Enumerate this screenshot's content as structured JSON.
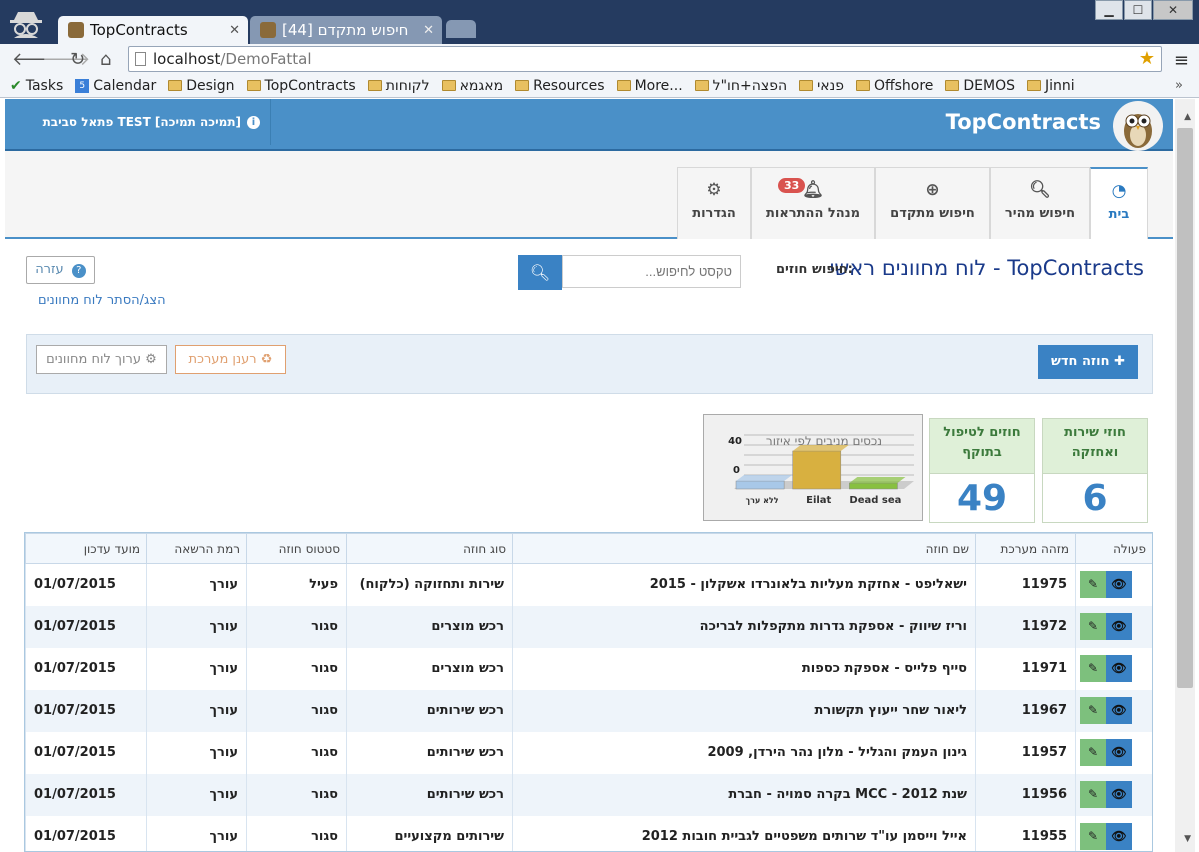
{
  "browser": {
    "tabs": [
      {
        "title": "TopContracts"
      },
      {
        "title": "[44] חיפוש מתקדם"
      }
    ],
    "url_host": "localhost",
    "url_path": "/DemoFattal",
    "window_buttons": {
      "min": "▁",
      "max": "☐",
      "close": "✕"
    },
    "bookmarks": [
      "Tasks",
      "Calendar",
      "Design",
      "TopContracts",
      "לקוחות",
      "מאגמא",
      "Resources",
      "More...",
      "הפצה+חו\"ל",
      "פנאי",
      "Offshore",
      "DEMOS",
      "Jinni"
    ],
    "bookmarks_more": "»"
  },
  "header": {
    "logo": "TopContracts",
    "env": "פתאל סביבת TEST [תמיכה תמיכה]"
  },
  "nav": {
    "tabs": [
      {
        "label": "בית",
        "icon": "dashboard-icon"
      },
      {
        "label": "חיפוש מהיר",
        "icon": "search-icon"
      },
      {
        "label": "חיפוש מתקדם",
        "icon": "zoom-in-icon"
      },
      {
        "label": "מנהל ההתראות",
        "icon": "bell-icon",
        "badge": "33"
      },
      {
        "label": "הגדרות",
        "icon": "gear-icon"
      }
    ]
  },
  "page": {
    "title": "לוח מחוונים ראשי - TopContracts",
    "search_label": "חיפוש חוזים:",
    "search_placeholder": "טקסט לחיפוש...",
    "help": "עזרה",
    "toggle_dashboard": "הצג/הסתר לוח מחוונים",
    "new_contract": "חוזה חדש",
    "refresh_system": "רענן מערכת",
    "edit_dashboard": "ערוך לוח מחוונים"
  },
  "stats": [
    {
      "label": "חוזי שירות ואחזקה",
      "value": "6"
    },
    {
      "label": "חוזים לטיפול בתוקף",
      "value": "49"
    }
  ],
  "chart_data": {
    "type": "bar",
    "title": "נכסים מניבים לפי איזור",
    "categories": [
      "ללא ערך",
      "Eilat",
      "Dead sea"
    ],
    "values": [
      8,
      38,
      6
    ],
    "ylim": [
      0,
      40
    ],
    "yticks": [
      "0",
      "40"
    ],
    "colors": [
      "#a8c8e8",
      "#d8b040",
      "#88c040"
    ]
  },
  "grid": {
    "columns": [
      "פעולה",
      "מזהה מערכת",
      "שם חוזה",
      "סוג חוזה",
      "סטטוס חוזה",
      "רמת הרשאה",
      "מועד עדכון"
    ],
    "rows": [
      {
        "id": "11975",
        "name": "ישאליפט - אחזקת מעליות בלאונרדו אשקלון - 2015",
        "type": "שירות ותחזוקה (כלקוח)",
        "status": "פעיל",
        "perm": "עורך",
        "date": "01/07/2015"
      },
      {
        "id": "11972",
        "name": "וריז שיווק - אספקת גדרות מתקפלות לבריכה",
        "type": "רכש מוצרים",
        "status": "סגור",
        "perm": "עורך",
        "date": "01/07/2015"
      },
      {
        "id": "11971",
        "name": "סייף פלייס - אספקת כספות",
        "type": "רכש מוצרים",
        "status": "סגור",
        "perm": "עורך",
        "date": "01/07/2015"
      },
      {
        "id": "11967",
        "name": "ליאור שחר ייעוץ תקשורת",
        "type": "רכש שירותים",
        "status": "סגור",
        "perm": "עורך",
        "date": "01/07/2015"
      },
      {
        "id": "11957",
        "name": "גינון העמק והגליל - מלון נהר הירדן, 2009",
        "type": "רכש שירותים",
        "status": "סגור",
        "perm": "עורך",
        "date": "01/07/2015"
      },
      {
        "id": "11956",
        "name": "בקרה סמויה - חברת MCC - שנת 2012",
        "type": "רכש שירותים",
        "status": "סגור",
        "perm": "עורך",
        "date": "01/07/2015"
      },
      {
        "id": "11955",
        "name": "אייל וייסמן עו\"ד שרותים משפטיים לגביית חובות 2012",
        "type": "שירותים מקצועיים",
        "status": "סגור",
        "perm": "עורך",
        "date": "01/07/2015"
      }
    ]
  }
}
